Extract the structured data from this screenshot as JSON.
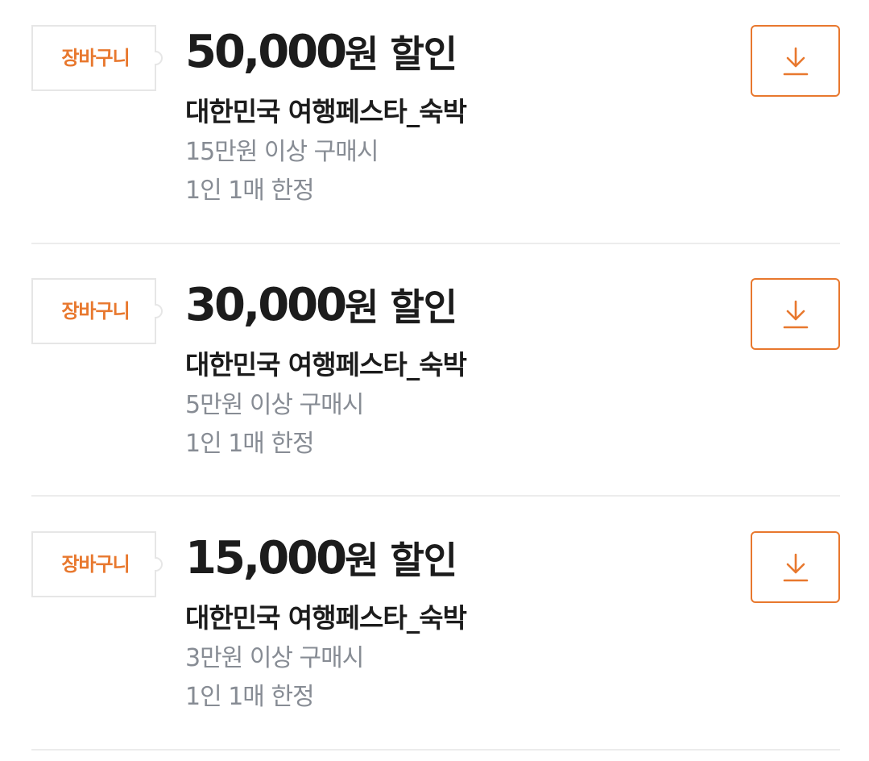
{
  "colors": {
    "accent": "#e8782e",
    "text_primary": "#1c1c1c",
    "text_secondary": "#878c94",
    "divider": "#ececec"
  },
  "coupons": [
    {
      "tag_label": "장바구니",
      "amount": "50,000",
      "amount_suffix": "원 할인",
      "title": "대한민국 여행페스타_숙박",
      "condition": "15만원 이상 구매시",
      "limit": "1인 1매 한정",
      "action_icon": "download-icon"
    },
    {
      "tag_label": "장바구니",
      "amount": "30,000",
      "amount_suffix": "원 할인",
      "title": "대한민국 여행페스타_숙박",
      "condition": "5만원 이상 구매시",
      "limit": "1인 1매 한정",
      "action_icon": "download-icon"
    },
    {
      "tag_label": "장바구니",
      "amount": "15,000",
      "amount_suffix": "원 할인",
      "title": "대한민국 여행페스타_숙박",
      "condition": "3만원 이상 구매시",
      "limit": "1인 1매 한정",
      "action_icon": "download-icon"
    }
  ]
}
